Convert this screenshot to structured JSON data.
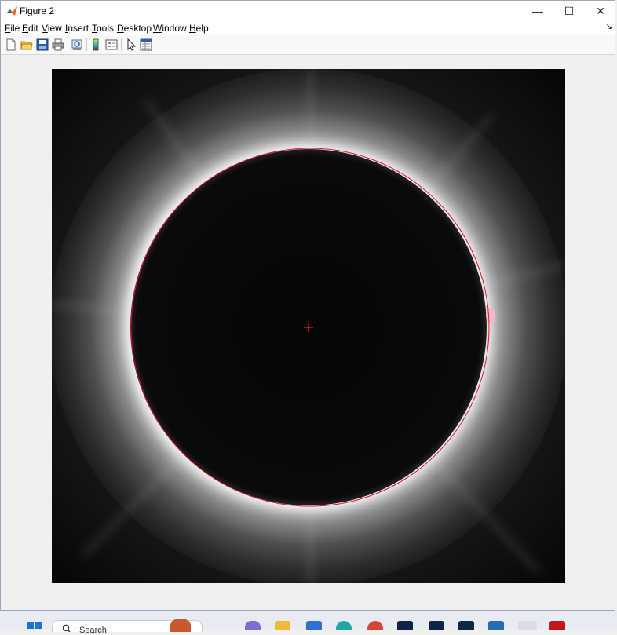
{
  "window": {
    "title": "Figure 2",
    "controls": {
      "minimize": "—",
      "maximize": "☐",
      "close": "✕"
    }
  },
  "menu": [
    {
      "label": "File",
      "mnemonic": "F",
      "rest": "ile"
    },
    {
      "label": "Edit",
      "mnemonic": "E",
      "rest": "dit"
    },
    {
      "label": "View",
      "mnemonic": "V",
      "rest": "iew"
    },
    {
      "label": "Insert",
      "mnemonic": "I",
      "rest": "nsert"
    },
    {
      "label": "Tools",
      "mnemonic": "T",
      "rest": "ools"
    },
    {
      "label": "Desktop",
      "mnemonic": "D",
      "rest": "esktop"
    },
    {
      "label": "Window",
      "mnemonic": "W",
      "rest": "indow"
    },
    {
      "label": "Help",
      "mnemonic": "H",
      "rest": "elp"
    }
  ],
  "toolbar": {
    "icons": [
      "new-figure-icon",
      "open-file-icon",
      "save-icon",
      "print-icon",
      "print-preview-icon",
      "colorbar-icon",
      "legend-icon",
      "edit-plot-arrow-icon",
      "property-inspector-icon"
    ]
  },
  "figure": {
    "image": "solar-eclipse-corona",
    "overlay_color": "#e0102a",
    "marker": "+"
  },
  "taskbar": {
    "search_text": "Search",
    "icons": [
      "windows-start-icon",
      "search-icon",
      "widgets-icon",
      "teams-icon",
      "file-explorer-icon",
      "store-icon",
      "edge-icon",
      "chrome-icon",
      "photoshop-icon",
      "photoshop-icon-2",
      "lightroom-icon",
      "mail-icon",
      "matlab-icon",
      "app-icon"
    ]
  }
}
